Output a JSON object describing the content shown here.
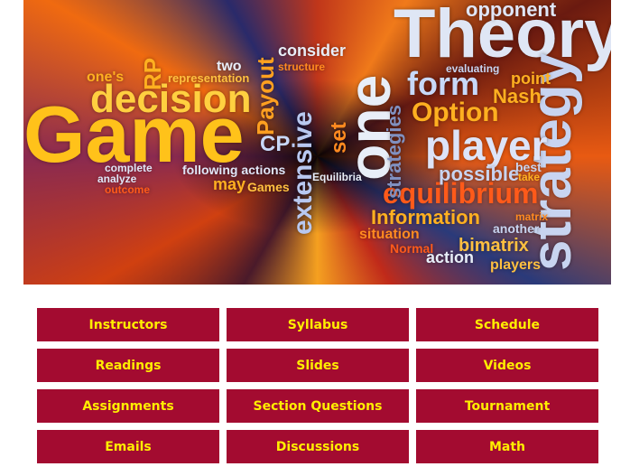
{
  "banner": {
    "words": [
      {
        "text": "Game",
        "color": "#ffc21a"
      },
      {
        "text": "Theory",
        "color": "#dfe6f5"
      },
      {
        "text": "decision",
        "color": "#ffd040"
      },
      {
        "text": "strategy",
        "color": "#c8d4f0"
      },
      {
        "text": "player",
        "color": "#dde4f8"
      },
      {
        "text": "equilibrium",
        "color": "#ff5a1a"
      },
      {
        "text": "Option",
        "color": "#ffb020"
      },
      {
        "text": "form",
        "color": "#c8d8f8"
      },
      {
        "text": "one",
        "color": "#e8eef8"
      },
      {
        "text": "extensive",
        "color": "#b8c8f0"
      },
      {
        "text": "Information",
        "color": "#ffb020"
      },
      {
        "text": "Payout",
        "color": "#ffa020"
      },
      {
        "text": "consider",
        "color": "#e8eef8"
      },
      {
        "text": "opponent",
        "color": "#e0e6f8"
      },
      {
        "text": "Nash",
        "color": "#ffb020"
      },
      {
        "text": "possible",
        "color": "#c8d4f0"
      },
      {
        "text": "bimatrix",
        "color": "#ffc040"
      },
      {
        "text": "players",
        "color": "#ffc040"
      },
      {
        "text": "action",
        "color": "#e8eef8"
      },
      {
        "text": "situation",
        "color": "#ff8a20"
      },
      {
        "text": "Normal",
        "color": "#ff5a1a"
      },
      {
        "text": "following actions",
        "color": "#e0e6f8"
      },
      {
        "text": "representation",
        "color": "#ffc040"
      },
      {
        "text": "one's",
        "color": "#ffb020"
      },
      {
        "text": "CP",
        "color": "#c8d8f8"
      },
      {
        "text": "may",
        "color": "#ffb020"
      },
      {
        "text": "Games",
        "color": "#ffc040"
      },
      {
        "text": "point",
        "color": "#ffb020"
      },
      {
        "text": "strategies",
        "color": "#8090c0"
      },
      {
        "text": "set",
        "color": "#ff8a20"
      },
      {
        "text": "RP",
        "color": "#ffb020"
      },
      {
        "text": "two",
        "color": "#e8eef8"
      },
      {
        "text": "structure",
        "color": "#ff8a20"
      },
      {
        "text": "evaluating",
        "color": "#c8d4f0"
      },
      {
        "text": "Equilibria",
        "color": "#e8eef8"
      },
      {
        "text": "complete",
        "color": "#e0e6f8"
      },
      {
        "text": "analyze",
        "color": "#e0e6f8"
      },
      {
        "text": "outcome",
        "color": "#ff5a1a"
      },
      {
        "text": "another",
        "color": "#c8d4f0"
      },
      {
        "text": "matrix",
        "color": "#ff8a20"
      },
      {
        "text": "best",
        "color": "#c8d4f0"
      },
      {
        "text": "take",
        "color": "#ffb020"
      }
    ]
  },
  "nav": [
    {
      "label": "Instructors"
    },
    {
      "label": "Syllabus"
    },
    {
      "label": "Schedule"
    },
    {
      "label": "Readings"
    },
    {
      "label": "Slides"
    },
    {
      "label": "Videos"
    },
    {
      "label": "Assignments"
    },
    {
      "label": "Section Questions"
    },
    {
      "label": "Tournament"
    },
    {
      "label": "Emails"
    },
    {
      "label": "Discussions"
    },
    {
      "label": "Math"
    }
  ],
  "colors": {
    "button_bg": "#a30b30",
    "button_text": "#ffee00"
  }
}
